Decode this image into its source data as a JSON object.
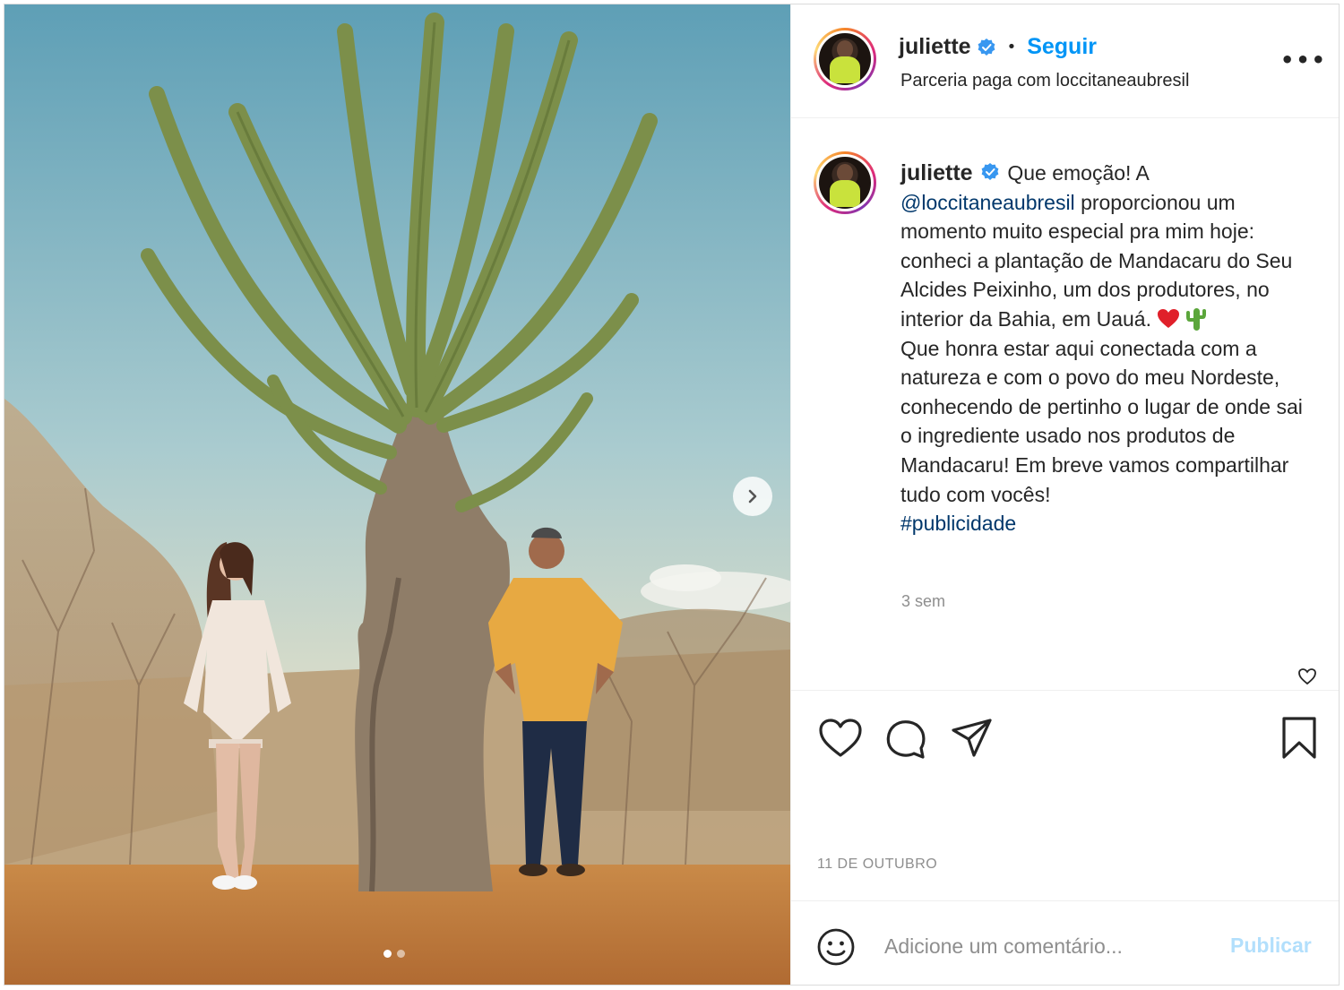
{
  "post": {
    "author": "juliette",
    "follow_label": "Seguir",
    "separator": "•",
    "partnership": "Parceria paga com loccitaneaubresil",
    "more_icon": "more-options-icon",
    "more_label": "•••"
  },
  "caption": {
    "author": "juliette",
    "text_1": "Que emoção! A",
    "mention": "@loccitaneaubresil",
    "text_2": "proporcionou um momento muito especial pra mim hoje: conheci a plantação de Mandacaru do Seu Alcides Peixinho, um dos produtores, no interior da Bahia, em Uauá.",
    "emoji_1": "heart-emoji",
    "emoji_2": "cactus-emoji",
    "text_3": "Que honra estar aqui conectada com a natureza e com o povo do meu Nordeste, conhecendo de pertinho o lugar de onde sai o ingrediente usado nos produtos de Mandacaru! Em breve vamos compartilhar tudo com vocês!",
    "hashtag": "#publicidade",
    "time": "3 sem"
  },
  "actions": {
    "like_icon": "heart-icon",
    "comment_icon": "comment-icon",
    "share_icon": "paper-plane-icon",
    "save_icon": "bookmark-icon",
    "date": "11 DE OUTUBRO"
  },
  "comment_box": {
    "emoji_icon": "smiley-icon",
    "placeholder": "Adicione um comentário...",
    "publish_label": "Publicar"
  },
  "carousel": {
    "slides": 2,
    "current": 1,
    "next_icon": "chevron-right-icon"
  },
  "colors": {
    "link": "#0095f6",
    "mention": "#00376b",
    "muted": "#8e8e8e",
    "publish_disabled": "#b2dffc",
    "verified": "#3897f0"
  }
}
